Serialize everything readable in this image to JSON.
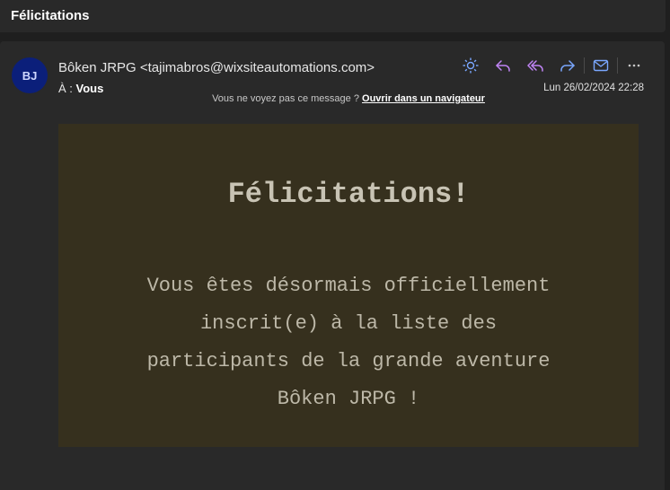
{
  "email": {
    "subject": "Félicitations",
    "avatar_initials": "BJ",
    "sender": "Bôken JRPG <tajimabros@wixsiteautomations.com>",
    "to_label": "À :",
    "to_name": "Vous",
    "date": "Lun 26/02/2024 22:28",
    "toolbar_icons": [
      "sun-icon",
      "reply-icon",
      "reply-all-icon",
      "forward-icon",
      "mail-icon",
      "more-icon"
    ],
    "notice_text": "Vous ne voyez pas ce message ?",
    "notice_link": "Ouvrir dans un navigateur",
    "body": {
      "headline": "Félicitations!",
      "text": "Vous êtes désormais officiellement inscrit(e) à la liste des participants de la grande aventure Bôken JRPG !"
    }
  },
  "colors": {
    "accent_blue": "#7aa7ff",
    "accent_purple": "#c084f5",
    "message_bg": "#36301e"
  }
}
